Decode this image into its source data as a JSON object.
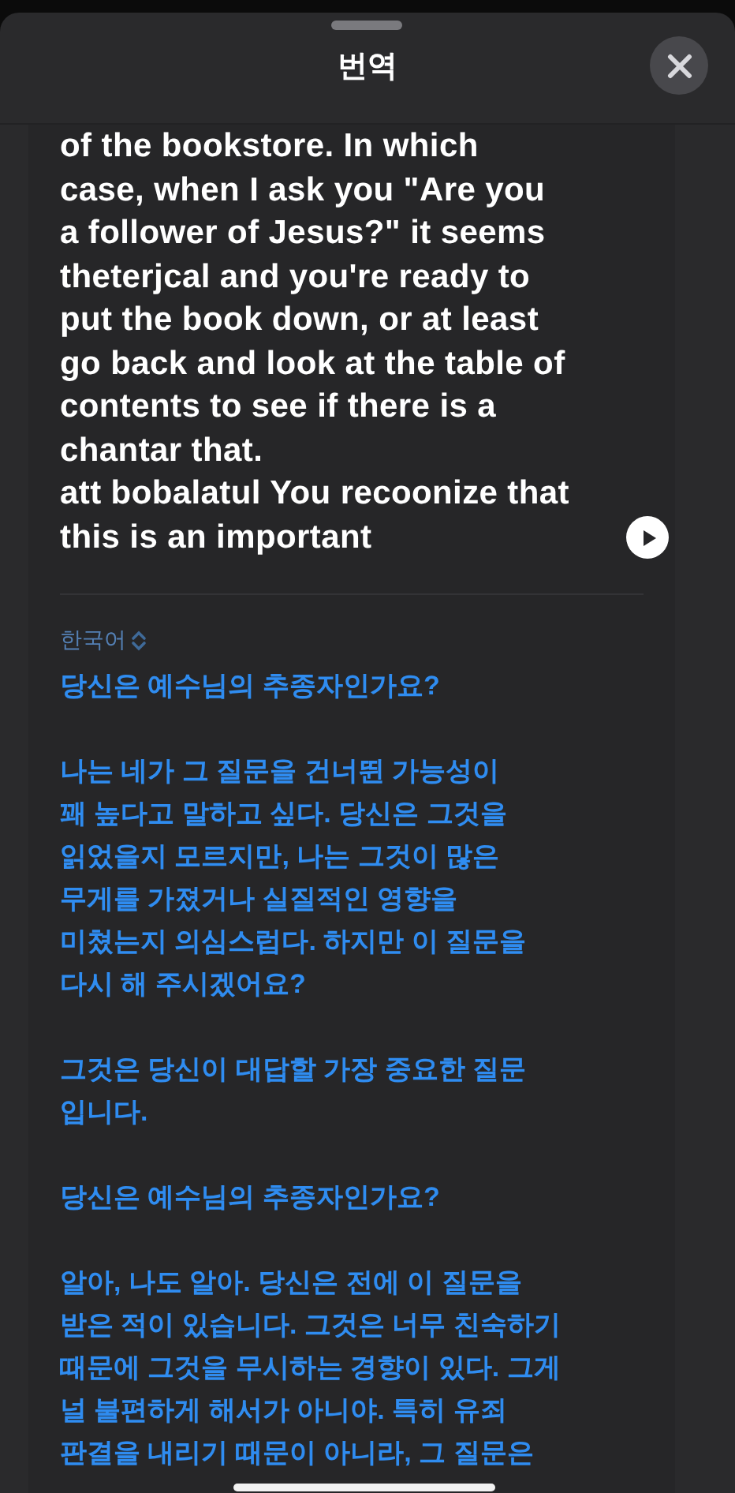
{
  "header": {
    "title": "번역"
  },
  "source": {
    "text": "of the bookstore. In which\ncase, when I ask you \"Are you\na follower of Jesus?\" it seems\ntheterjcal and you're ready to\nput the book down, or at least\ngo back and look at the table of\ncontents to see if there is a\nchantar that.\natt bobalatul You recoonize that\nthis is an important"
  },
  "target": {
    "language": "한국어",
    "paragraphs": [
      "당신은 예수님의 추종자인가요?",
      "나는 네가 그 질문을 건너뛴 가능성이\n꽤 높다고 말하고 싶다. 당신은 그것을\n읽었을지 모르지만, 나는 그것이 많은\n무게를 가졌거나 실질적인 영향을\n미쳤는지 의심스럽다. 하지만 이 질문을\n다시 해 주시겠어요?",
      "그것은 당신이 대답할 가장 중요한 질문\n입니다.",
      "당신은 예수님의 추종자인가요?",
      "알아, 나도 알아. 당신은 전에 이 질문을\n받은 적이 있습니다. 그것은 너무 친숙하기\n때문에 그것을 무시하는 경향이 있다. 그게\n널 불편하게 해서가 아니야. 특히 유죄\n판결을 내리기 때문이 아니라, 그 질문은"
    ]
  }
}
